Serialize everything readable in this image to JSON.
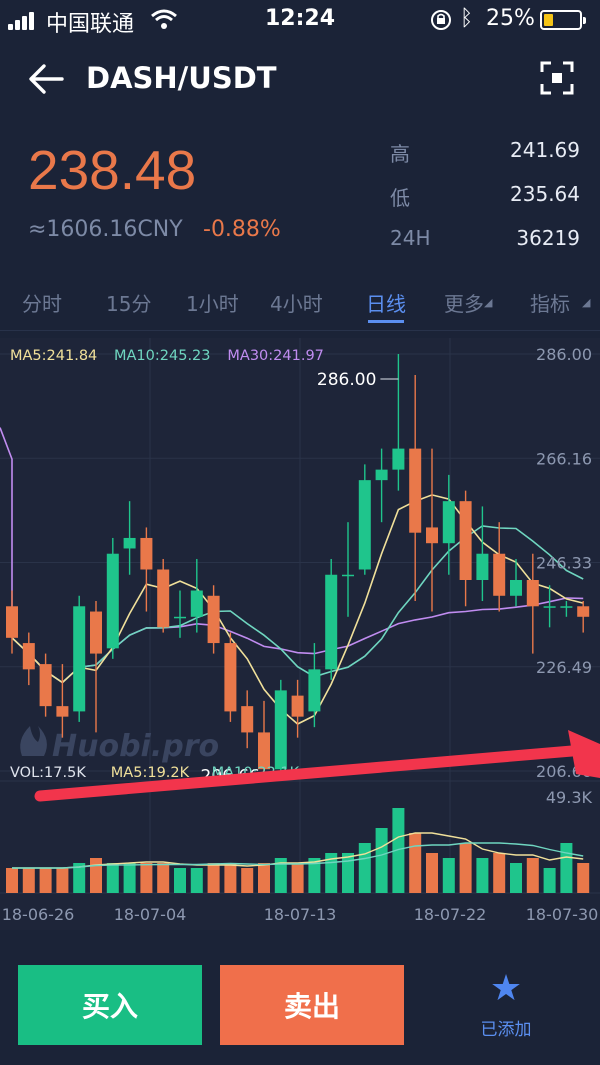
{
  "status_bar": {
    "carrier": "中国联通",
    "time": "12:24",
    "battery": "25%"
  },
  "header": {
    "pair": "DASH/USDT",
    "back_icon": "arrow-left-icon",
    "scan_icon": "fullscreen-icon"
  },
  "ticker": {
    "price": "238.48",
    "cny": "≈1606.16CNY",
    "change": "-0.88%",
    "stats": [
      {
        "label": "高",
        "value": "241.69"
      },
      {
        "label": "低",
        "value": "235.64"
      },
      {
        "label": "24H",
        "value": "36219"
      }
    ]
  },
  "tabs": [
    {
      "label": "分时"
    },
    {
      "label": "15分"
    },
    {
      "label": "1小时"
    },
    {
      "label": "4小时"
    },
    {
      "label": "日线",
      "active": true
    },
    {
      "label": "更多"
    },
    {
      "label": "指标"
    }
  ],
  "chart": {
    "ma_legend": [
      {
        "label": "MA5:241.84",
        "color": "#f0e09a"
      },
      {
        "label": "MA10:245.23",
        "color": "#6fd6c0"
      },
      {
        "label": "MA30:241.97",
        "color": "#c08cf0"
      }
    ],
    "vol_legend": [
      {
        "label": "VOL:17.5K",
        "color": "#dfe3ec"
      },
      {
        "label": "MA5:19.2K",
        "color": "#f0e09a"
      },
      {
        "label": "MA10:22.1K",
        "color": "#6fd6c0"
      }
    ],
    "watermark": "Huobi.pro",
    "high_marker": "286.00",
    "low_marker": "206.66",
    "colors": {
      "up": "#1fc58c",
      "down": "#e9784a"
    }
  },
  "chart_data": {
    "type": "candlestick",
    "price_axis_ticks": [
      "286.00",
      "266.16",
      "246.33",
      "226.49",
      "206.66"
    ],
    "volume_axis_max": "49.3K",
    "x_tick_labels": [
      "18-06-26",
      "18-07-04",
      "18-07-13",
      "18-07-22",
      "18-07-30"
    ],
    "ylim": [
      206.66,
      286.0
    ],
    "candles": [
      {
        "o": 238,
        "c": 232,
        "h": 241,
        "l": 229,
        "v": 5
      },
      {
        "o": 231,
        "c": 226,
        "h": 233,
        "l": 223,
        "v": 5
      },
      {
        "o": 227,
        "c": 219,
        "h": 229,
        "l": 217,
        "v": 5
      },
      {
        "o": 219,
        "c": 217,
        "h": 227,
        "l": 213,
        "v": 5
      },
      {
        "o": 218,
        "c": 238,
        "h": 240,
        "l": 216,
        "v": 6
      },
      {
        "o": 237,
        "c": 229,
        "h": 239,
        "l": 214,
        "v": 7
      },
      {
        "o": 230,
        "c": 248,
        "h": 251,
        "l": 228,
        "v": 6
      },
      {
        "o": 249,
        "c": 251,
        "h": 258,
        "l": 244,
        "v": 6
      },
      {
        "o": 251,
        "c": 245,
        "h": 253,
        "l": 237,
        "v": 6
      },
      {
        "o": 245,
        "c": 234,
        "h": 247,
        "l": 233,
        "v": 6
      },
      {
        "o": 236,
        "c": 236,
        "h": 241,
        "l": 232,
        "v": 5
      },
      {
        "o": 236,
        "c": 241,
        "h": 247,
        "l": 233,
        "v": 5
      },
      {
        "o": 240,
        "c": 231,
        "h": 242,
        "l": 229,
        "v": 6
      },
      {
        "o": 231,
        "c": 218,
        "h": 233,
        "l": 216,
        "v": 6
      },
      {
        "o": 219,
        "c": 214,
        "h": 222,
        "l": 211,
        "v": 5
      },
      {
        "o": 214,
        "c": 207,
        "h": 220,
        "l": 205,
        "v": 6
      },
      {
        "o": 207,
        "c": 222,
        "h": 224,
        "l": 206,
        "v": 7
      },
      {
        "o": 221,
        "c": 217,
        "h": 224,
        "l": 213,
        "v": 6
      },
      {
        "o": 218,
        "c": 226,
        "h": 231,
        "l": 215,
        "v": 7
      },
      {
        "o": 226,
        "c": 244,
        "h": 247,
        "l": 224,
        "v": 8
      },
      {
        "o": 244,
        "c": 244,
        "h": 254,
        "l": 236,
        "v": 8
      },
      {
        "o": 245,
        "c": 262,
        "h": 265,
        "l": 244,
        "v": 10
      },
      {
        "o": 262,
        "c": 264,
        "h": 268,
        "l": 254,
        "v": 13
      },
      {
        "o": 264,
        "c": 268,
        "h": 286,
        "l": 260,
        "v": 17
      },
      {
        "o": 268,
        "c": 252,
        "h": 282,
        "l": 239,
        "v": 12
      },
      {
        "o": 253,
        "c": 250,
        "h": 268,
        "l": 237,
        "v": 8
      },
      {
        "o": 250,
        "c": 258,
        "h": 263,
        "l": 244,
        "v": 7
      },
      {
        "o": 258,
        "c": 243,
        "h": 260,
        "l": 238,
        "v": 10
      },
      {
        "o": 243,
        "c": 248,
        "h": 257,
        "l": 239,
        "v": 7
      },
      {
        "o": 248,
        "c": 240,
        "h": 254,
        "l": 237,
        "v": 8
      },
      {
        "o": 240,
        "c": 243,
        "h": 247,
        "l": 238,
        "v": 6
      },
      {
        "o": 243,
        "c": 238,
        "h": 248,
        "l": 229,
        "v": 7
      },
      {
        "o": 238,
        "c": 238,
        "h": 242,
        "l": 234,
        "v": 5
      },
      {
        "o": 238,
        "c": 238,
        "h": 239,
        "l": 236,
        "v": 10
      },
      {
        "o": 238,
        "c": 236,
        "h": 239,
        "l": 233,
        "v": 6
      }
    ]
  }
}
